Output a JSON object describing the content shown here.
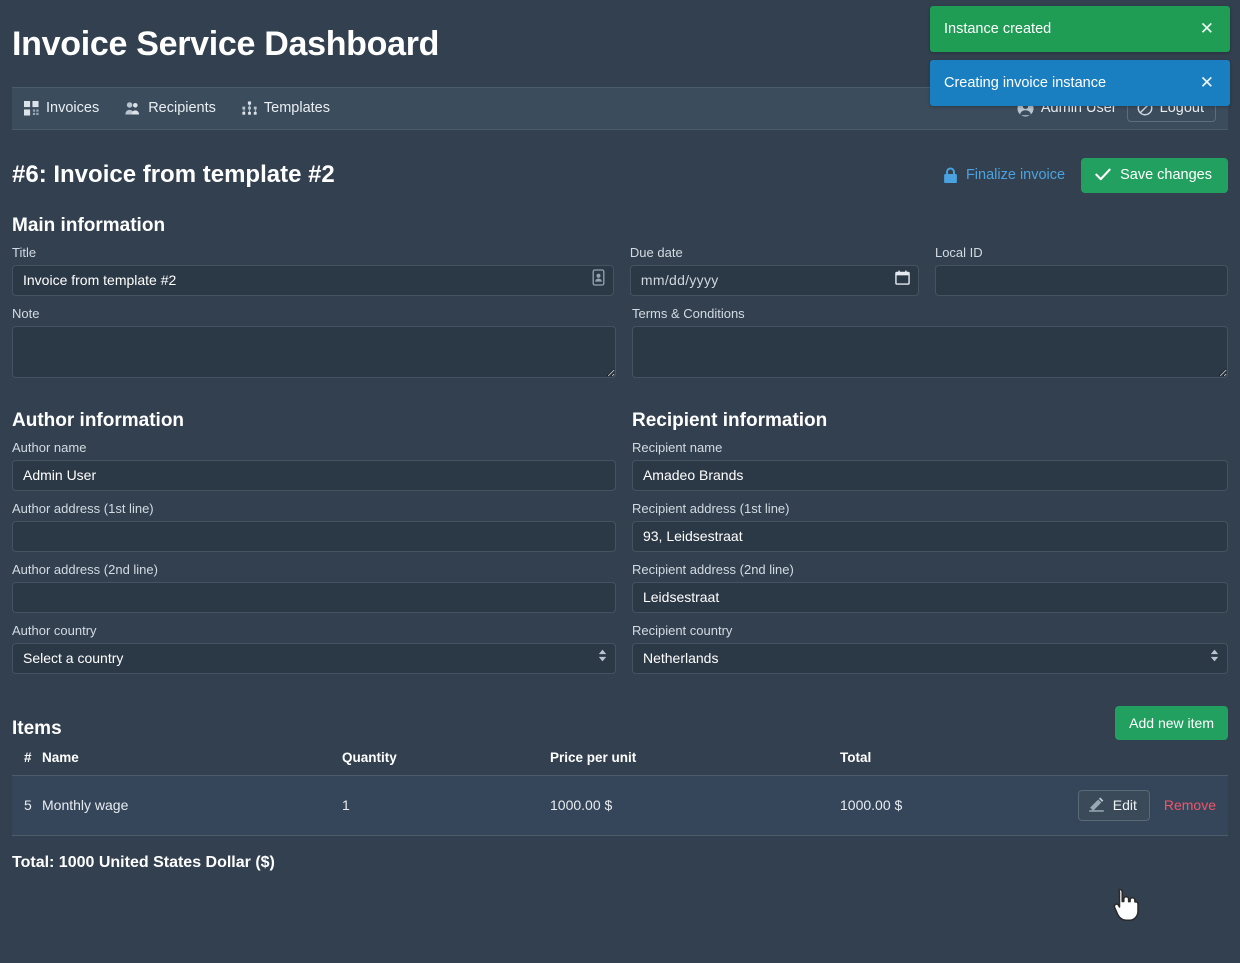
{
  "app": {
    "title": "Invoice Service Dashboard"
  },
  "nav": {
    "items": [
      {
        "label": "Invoices",
        "icon": "grid-icon"
      },
      {
        "label": "Recipients",
        "icon": "people-icon"
      },
      {
        "label": "Templates",
        "icon": "sitemap-icon"
      }
    ],
    "user": {
      "label": "Admin User",
      "icon": "user-circle-icon"
    },
    "logout": {
      "label": "Logout",
      "icon": "ban-icon"
    }
  },
  "toasts": [
    {
      "message": "Instance created",
      "type": "success",
      "color": "#1f9d55",
      "close": "✕"
    },
    {
      "message": "Creating invoice instance",
      "type": "info",
      "color": "#1a7fc1",
      "close": "✕"
    }
  ],
  "invoice": {
    "heading": "#6: Invoice from template #2",
    "finalize_label": "Finalize invoice",
    "save_label": "Save changes"
  },
  "main_information": {
    "heading": "Main information",
    "title": {
      "label": "Title",
      "value": "Invoice from template #2",
      "placeholder": ""
    },
    "due_date": {
      "label": "Due date",
      "value": "",
      "placeholder": "mm/dd/yyyy"
    },
    "local_id": {
      "label": "Local ID",
      "value": "",
      "placeholder": ""
    },
    "note": {
      "label": "Note",
      "value": "",
      "placeholder": ""
    },
    "terms": {
      "label": "Terms & Conditions",
      "value": "",
      "placeholder": ""
    }
  },
  "author_information": {
    "heading": "Author information",
    "name": {
      "label": "Author name",
      "value": "Admin User"
    },
    "address1": {
      "label": "Author address (1st line)",
      "value": ""
    },
    "address2": {
      "label": "Author address (2nd line)",
      "value": ""
    },
    "country": {
      "label": "Author country",
      "value": "Select a country"
    }
  },
  "recipient_information": {
    "heading": "Recipient information",
    "name": {
      "label": "Recipient name",
      "value": "Amadeo Brands"
    },
    "address1": {
      "label": "Recipient address (1st line)",
      "value": "93, Leidsestraat"
    },
    "address2": {
      "label": "Recipient address (2nd line)",
      "value": "Leidsestraat"
    },
    "country": {
      "label": "Recipient country",
      "value": "Netherlands"
    }
  },
  "items": {
    "heading": "Items",
    "add_label": "Add new item",
    "columns": [
      "#",
      "Name",
      "Quantity",
      "Price per unit",
      "Total"
    ],
    "rows": [
      {
        "num": "5",
        "name": "Monthly wage",
        "quantity": "1",
        "price_per_unit": "1000.00 $",
        "total": "1000.00 $",
        "edit_label": "Edit",
        "remove_label": "Remove"
      }
    ],
    "total_line": "Total: 1000 United States Dollar ($)"
  },
  "theme": {
    "page_bg": "#32404f",
    "navbar_bg": "#3b4c5c",
    "input_bg": "#2b3845",
    "accent_green": "#22a060",
    "accent_blue": "#4aa3e0",
    "danger_red": "#f0556a"
  }
}
